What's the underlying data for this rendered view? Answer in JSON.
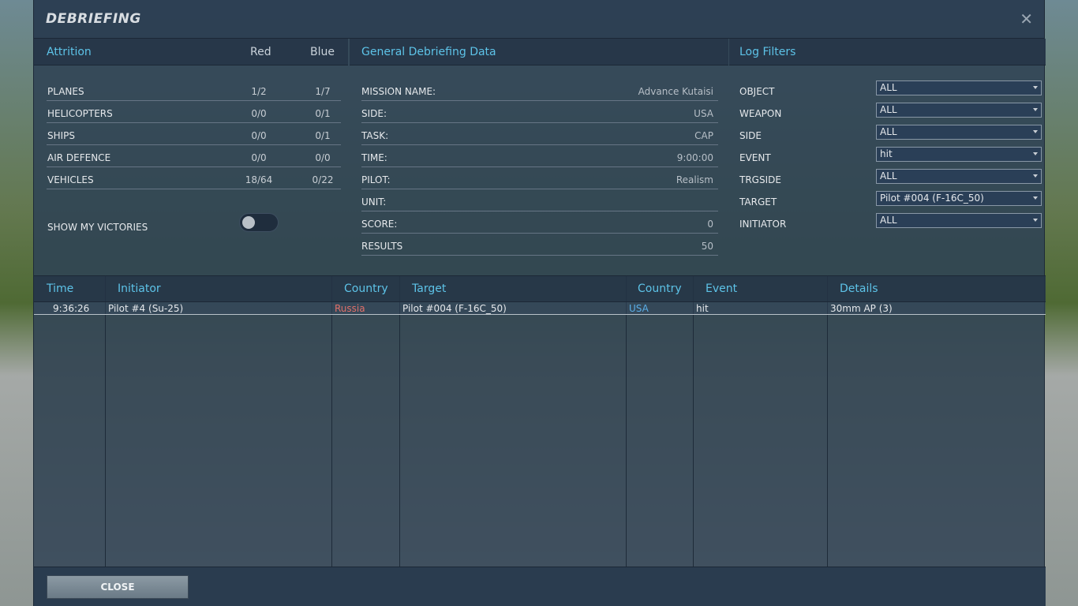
{
  "window": {
    "title": "DEBRIEFING",
    "close_glyph": "✕"
  },
  "attrition": {
    "header": "Attrition",
    "red_header": "Red",
    "blue_header": "Blue",
    "rows": [
      {
        "label": "PLANES",
        "red": "1/2",
        "blue": "1/7"
      },
      {
        "label": "HELICOPTERS",
        "red": "0/0",
        "blue": "0/1"
      },
      {
        "label": "SHIPS",
        "red": "0/0",
        "blue": "0/1"
      },
      {
        "label": "AIR DEFENCE",
        "red": "0/0",
        "blue": "0/0"
      },
      {
        "label": "VEHICLES",
        "red": "18/64",
        "blue": "0/22"
      }
    ],
    "show_victories_label": "SHOW MY VICTORIES",
    "show_victories_on": false
  },
  "general": {
    "header": "General Debriefing Data",
    "rows": [
      {
        "label": "MISSION NAME:",
        "value": "Advance Kutaisi"
      },
      {
        "label": "SIDE:",
        "value": "USA"
      },
      {
        "label": "TASK:",
        "value": "CAP"
      },
      {
        "label": "TIME:",
        "value": "9:00:00"
      },
      {
        "label": "PILOT:",
        "value": "Realism"
      },
      {
        "label": "UNIT:",
        "value": ""
      },
      {
        "label": "SCORE:",
        "value": "0"
      },
      {
        "label": "RESULTS",
        "value": "50"
      }
    ]
  },
  "filters": {
    "header": "Log Filters",
    "rows": [
      {
        "label": "OBJECT",
        "value": "ALL"
      },
      {
        "label": "WEAPON",
        "value": "ALL"
      },
      {
        "label": "SIDE",
        "value": "ALL"
      },
      {
        "label": "EVENT",
        "value": "hit"
      },
      {
        "label": "TRGSIDE",
        "value": "ALL"
      },
      {
        "label": "TARGET",
        "value": "Pilot #004 (F-16C_50)"
      },
      {
        "label": "INITIATOR",
        "value": "ALL"
      }
    ]
  },
  "log": {
    "columns": {
      "time": "Time",
      "initiator": "Initiator",
      "country": "Country",
      "target": "Target",
      "target_country": "Country",
      "event": "Event",
      "details": "Details"
    },
    "rows": [
      {
        "time": "9:36:26",
        "initiator": "Pilot #4 (Su-25)",
        "country": "Russia",
        "target": "Pilot #004 (F-16C_50)",
        "target_country": "USA",
        "event": "hit",
        "details": "30mm AP (3)"
      }
    ]
  },
  "footer": {
    "close_label": "CLOSE"
  },
  "colors": {
    "accent": "#5dc3e8",
    "red_side": "#e0706a",
    "blue_side": "#5aaee8"
  }
}
